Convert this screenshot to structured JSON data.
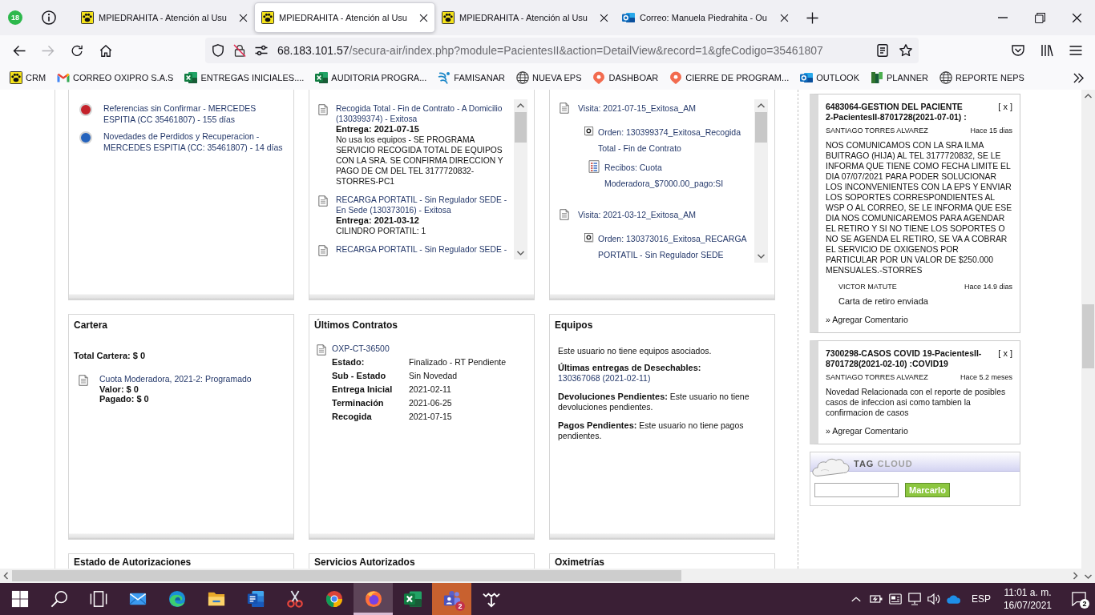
{
  "browser": {
    "chat_badge": "18",
    "tabs": [
      {
        "kind": "paw",
        "title": "MPIEDRAHITA - Atención al Usu",
        "selected": false
      },
      {
        "kind": "paw",
        "title": "MPIEDRAHITA - Atención al Usu",
        "selected": true
      },
      {
        "kind": "paw",
        "title": "MPIEDRAHITA - Atención al Usu",
        "selected": false
      },
      {
        "kind": "outlook",
        "title": "Correo: Manuela Piedrahita - Ou",
        "selected": false
      }
    ],
    "forward_disabled": true,
    "url": {
      "host": "68.183.101.57",
      "path": "/secura-air/index.php?module=PacientesII&action=DetailView&record=1&gfeCodigo=35461807"
    },
    "bookmarks": [
      {
        "kind": "paw",
        "label": "CRM"
      },
      {
        "kind": "gmail",
        "label": "CORREO OXIPRO S.A.S"
      },
      {
        "kind": "excel",
        "label": "ENTREGAS INICIALES...."
      },
      {
        "kind": "excel",
        "label": "AUDITORIA PROGRA..."
      },
      {
        "kind": "famisanar",
        "label": "FAMISANAR"
      },
      {
        "kind": "globe",
        "label": "NUEVA EPS"
      },
      {
        "kind": "pin",
        "label": "DASHBOAR"
      },
      {
        "kind": "pin",
        "label": "CIERRE DE PROGRAM..."
      },
      {
        "kind": "outlook",
        "label": "OUTLOOK"
      },
      {
        "kind": "planner",
        "label": "PLANNER"
      },
      {
        "kind": "globe",
        "label": "REPORTE NEPS"
      }
    ]
  },
  "alerts": [
    {
      "text": "Referencias sin Confirmar - MERCEDES ESPITIA (CC 35461807) - 155 días",
      "color": "#c4222b"
    },
    {
      "text": "Novedades de Perdidos y Recuperacion - MERCEDES ESPITIA (CC: 35461807) - 14 días",
      "color": "#2563bd"
    }
  ],
  "orders": [
    {
      "title": "Recogida Total - Fin de Contrato - A Domicilio (130399374) - Exitosa",
      "delivery": "Entrega: 2021-07-15",
      "note": "No usa los equipos - SE PROGRAMA SERVICIO RECOGIDA TOTAL DE EQUIPOS CON LA SRA. SE CONFIRMA DIRECCION Y PAGO DE CM DEL TEL 3177720832-STORRES-PC1"
    },
    {
      "title": "RECARGA PORTATIL - Sin Regulador SEDE - En Sede (130373016) - Exitosa",
      "delivery": "Entrega: 2021-03-12",
      "note": "CILINDRO PORTATIL: 1"
    },
    {
      "title": "RECARGA PORTATIL - Sin Regulador SEDE -"
    }
  ],
  "visits": [
    {
      "kind": "visit",
      "text": "Visita: 2021-07-15_Exitosa_AM",
      "children": [
        {
          "kind": "order",
          "text": "Orden: 130399374_Exitosa_Recogida Total - Fin de Contrato",
          "children": [
            {
              "kind": "receipt",
              "text": "Recibos: Cuota Moderadora_$7000.00_pago:SI"
            }
          ]
        }
      ]
    },
    {
      "kind": "visit",
      "text": "Visita: 2021-03-12_Exitosa_AM",
      "children": [
        {
          "kind": "order",
          "text": "Orden: 130373016_Exitosa_RECARGA PORTATIL - Sin Regulador SEDE"
        }
      ]
    }
  ],
  "cartera": {
    "title": "Cartera",
    "total": "Total Cartera: $ 0",
    "items": [
      {
        "text": "Cuota Moderadora, 2021-2: Programado",
        "value": "Valor: $ 0",
        "paid": "Pagado: $ 0"
      }
    ]
  },
  "contracts": {
    "title": "Últimos Contratos",
    "items": [
      {
        "code": "OXP-CT-36500",
        "fields": [
          {
            "label": "Estado:",
            "value": "Finalizado - RT Pendiente"
          },
          {
            "label": "Sub - Estado",
            "value": "Sin Novedad"
          },
          {
            "label": "Entrega Inicial",
            "value": "2021-02-11"
          },
          {
            "label": "Terminación",
            "value": "2021-06-25"
          },
          {
            "label": "Recogida",
            "value": "2021-07-15"
          }
        ]
      }
    ]
  },
  "equipos": {
    "title": "Equipos",
    "note": "Este usuario no tiene equipos asociados.",
    "disposables_label": "Últimas entregas de Desechables:",
    "disposables": "130367068 (2021-02-11)",
    "returns": "**Devoluciones Pendientes:** Este usuario no tiene devoluciones pendientes.",
    "payments": "**Pagos Pendientes:** Este usuario no tiene pagos pendientes."
  },
  "lower_panels": [
    {
      "title": "Estado de Autorizaciones"
    },
    {
      "title": "Servicios Autorizados"
    },
    {
      "title": "Oximetrías"
    }
  ],
  "comments": [
    {
      "title": "6483064-GESTION DEL PACIENTE 2-PacientesII-8701728(2021-07-01) :",
      "close": "[ x ]",
      "author": "SANTIAGO TORRES ALVAREZ",
      "time": "Hace 15 dias",
      "body": "NOS COMUNICAMOS CON LA SRA ILMA BUITRAGO (HIJA) AL TEL 3177720832, SE LE INFORMA QUE TIENE COMO FECHA LIMITE EL DIA 07/07/2021 PARA PODER SOLUCIONAR LOS INCONVENIENTES CON LA EPS Y ENVIAR LOS SOPORTES CORRESPONDIENTES AL WSP O AL CORREO, SE LE INFORMA QUE ESE DIA NOS COMUNICAREMOS PARA AGENDAR EL RETIRO Y SI NO TIENE LOS SOPORTES O NO SE AGENDA EL RETIRO, SE VA A COBRAR EL SERVICIO DE OXIGENOS POR PARTICULAR POR UN VALOR DE $250.000 MENSUALES.-STORRES",
      "replies": [
        {
          "author": "VICTOR MATUTE",
          "time": "Hace 14.9 dias",
          "text": "Carta de retiro enviada"
        }
      ],
      "add": "» Agregar Comentario"
    },
    {
      "title": "7300298-CASOS COVID 19-PacientesII-8701728(2021-02-10) :COVID19",
      "close": "[ x ]",
      "author": "SANTIAGO TORRES ALVAREZ",
      "time": "Hace 5.2 meses",
      "body": "Novedad Relacionada con el reporte de posibles casos de infeccion asi como tambien la confirmacion de casos",
      "add": "» Agregar Comentario"
    }
  ],
  "tag_cloud": {
    "title_main": "TAG",
    "title_sub": "CLOUD",
    "button": "Marcarlo"
  },
  "taskbar": {
    "apps": [
      {
        "kind": "start",
        "selected": false,
        "attention": false
      },
      {
        "kind": "search",
        "selected": false,
        "attention": false
      },
      {
        "kind": "task-view",
        "selected": false,
        "attention": false
      },
      {
        "kind": "mail",
        "selected": false,
        "attention": false
      },
      {
        "kind": "edge",
        "selected": false,
        "attention": false
      },
      {
        "kind": "explorer",
        "selected": false,
        "attention": false
      },
      {
        "kind": "word",
        "selected": false,
        "attention": false
      },
      {
        "kind": "snip",
        "selected": false,
        "attention": false
      },
      {
        "kind": "chrome",
        "selected": false,
        "attention": false
      },
      {
        "kind": "firefox",
        "selected": true,
        "attention": false
      },
      {
        "kind": "excel",
        "selected": false,
        "attention": false
      },
      {
        "kind": "teams",
        "selected": false,
        "attention": true,
        "badge": "2"
      },
      {
        "kind": "arrow-app",
        "selected": false,
        "attention": false
      }
    ],
    "language": "ESP",
    "time": "11:01 a. m.",
    "date": "16/07/2021",
    "notifications": "2"
  }
}
